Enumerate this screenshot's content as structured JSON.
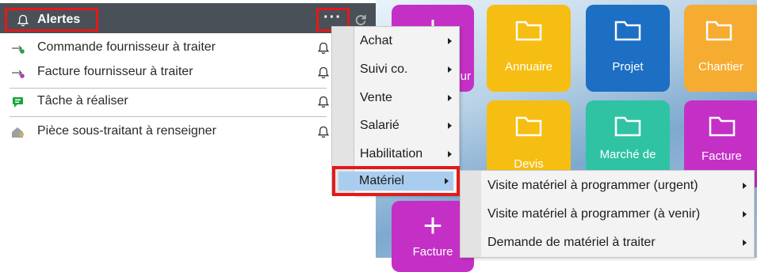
{
  "alerts": {
    "title": "Alertes",
    "more_label": "···",
    "items": [
      {
        "label": "Commande fournisseur à traiter",
        "icon": "arrow-right-green-dot-icon"
      },
      {
        "label": "Facture fournisseur à traiter",
        "icon": "arrow-right-purple-dot-icon"
      },
      {
        "label": "Tâche à réaliser",
        "icon": "task-comment-icon"
      },
      {
        "label": "Pièce sous-traitant à renseigner",
        "icon": "house-user-icon"
      }
    ]
  },
  "menu": {
    "items": [
      {
        "label": "Achat"
      },
      {
        "label": "Suivi co."
      },
      {
        "label": "Vente"
      },
      {
        "label": "Salarié"
      },
      {
        "label": "Habilitation"
      },
      {
        "label": "Matériel"
      }
    ]
  },
  "submenu": {
    "items": [
      {
        "label": "Visite matériel à programmer (urgent)"
      },
      {
        "label": "Visite matériel à programmer (à venir)"
      },
      {
        "label": "Demande de matériel à traiter"
      }
    ]
  },
  "tiles": {
    "plus_glyph": "+",
    "row1": [
      {
        "label": "ur",
        "color": "#c430c6"
      },
      {
        "label": "Annuaire",
        "color": "#f6be12"
      },
      {
        "label": "Projet",
        "color": "#1c6fc3"
      },
      {
        "label": "Chantier",
        "color": "#f6ac31"
      }
    ],
    "row2": [
      {
        "label": "Devis",
        "color": "#f6be12"
      },
      {
        "label": "Marché de",
        "color": "#2fc3a4"
      },
      {
        "label": "Facture",
        "color": "#c430c6"
      }
    ],
    "row3": [
      {
        "label": "Facture",
        "color": "#c430c6"
      }
    ]
  },
  "colors": {
    "header": "#4a5057",
    "highlight": "#e21a1a",
    "active_item": "#a9cdee"
  }
}
